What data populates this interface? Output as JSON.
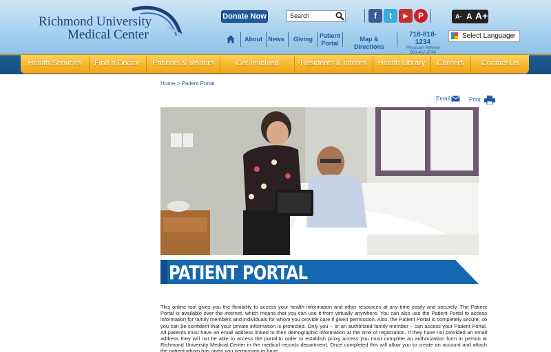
{
  "header": {
    "logo_line1": "Richmond University",
    "logo_line2": "Medical Center",
    "donate_label": "Donate Now",
    "search_placeholder": "Search",
    "social": [
      {
        "name": "facebook",
        "glyph": "f",
        "color": "#3b5998"
      },
      {
        "name": "twitter",
        "glyph": "t",
        "color": "#39a9e0"
      },
      {
        "name": "youtube",
        "glyph": "▶",
        "color": "#c4302b"
      },
      {
        "name": "pinterest",
        "glyph": "P",
        "color": "#cb2027"
      }
    ],
    "font_controls": [
      "A-",
      "A",
      "A+"
    ],
    "top_links": [
      "About",
      "News",
      "Giving",
      "Patient Portal",
      "Map & Directions"
    ],
    "phone_number": "718-818-1234",
    "phone_label": "Physician Referral",
    "phone_secondary": "800-422-8798",
    "language_label": "Select Language"
  },
  "main_nav": [
    "Health Services",
    "Find a Doctor",
    "Patients & Visitors",
    "Get  Involved",
    "Residents & Interns",
    "Health Library",
    "Careers",
    "Contact Us"
  ],
  "breadcrumb": {
    "home": "Home",
    "separator": ">",
    "current": "Patient Portal"
  },
  "utility": {
    "email": "Email",
    "print": "Print"
  },
  "banner_title": "PATIENT PORTAL",
  "body_text": "This online tool gives you the flexibility to access your health information and other resources at any time easily and securely. The Patient Portal is available over the internet, which means that you can use it from virtually anywhere. You can also use the Patient Portal to access information for family members and individuals for whom you provide care if given permission. Also, the Patient Portal is completely secure, so you can be confident that your private information is protected. Only you – or an authorized family member – can access your Patient Portal. All patients must have an email address linked to their demographic information at the time of registration. If they have not provided an email address they will not be able to access the portal.In order to establish proxy access you must complete an authorization form in person at Richmond University Medical Center in the medical records department. Once completed this will allow you to create an account and attach the patient whom has given you permission to have",
  "colors": {
    "brand_blue": "#1f5a9f",
    "nav_orange": "#f7b52b",
    "banner_blue": "#1568b0"
  }
}
